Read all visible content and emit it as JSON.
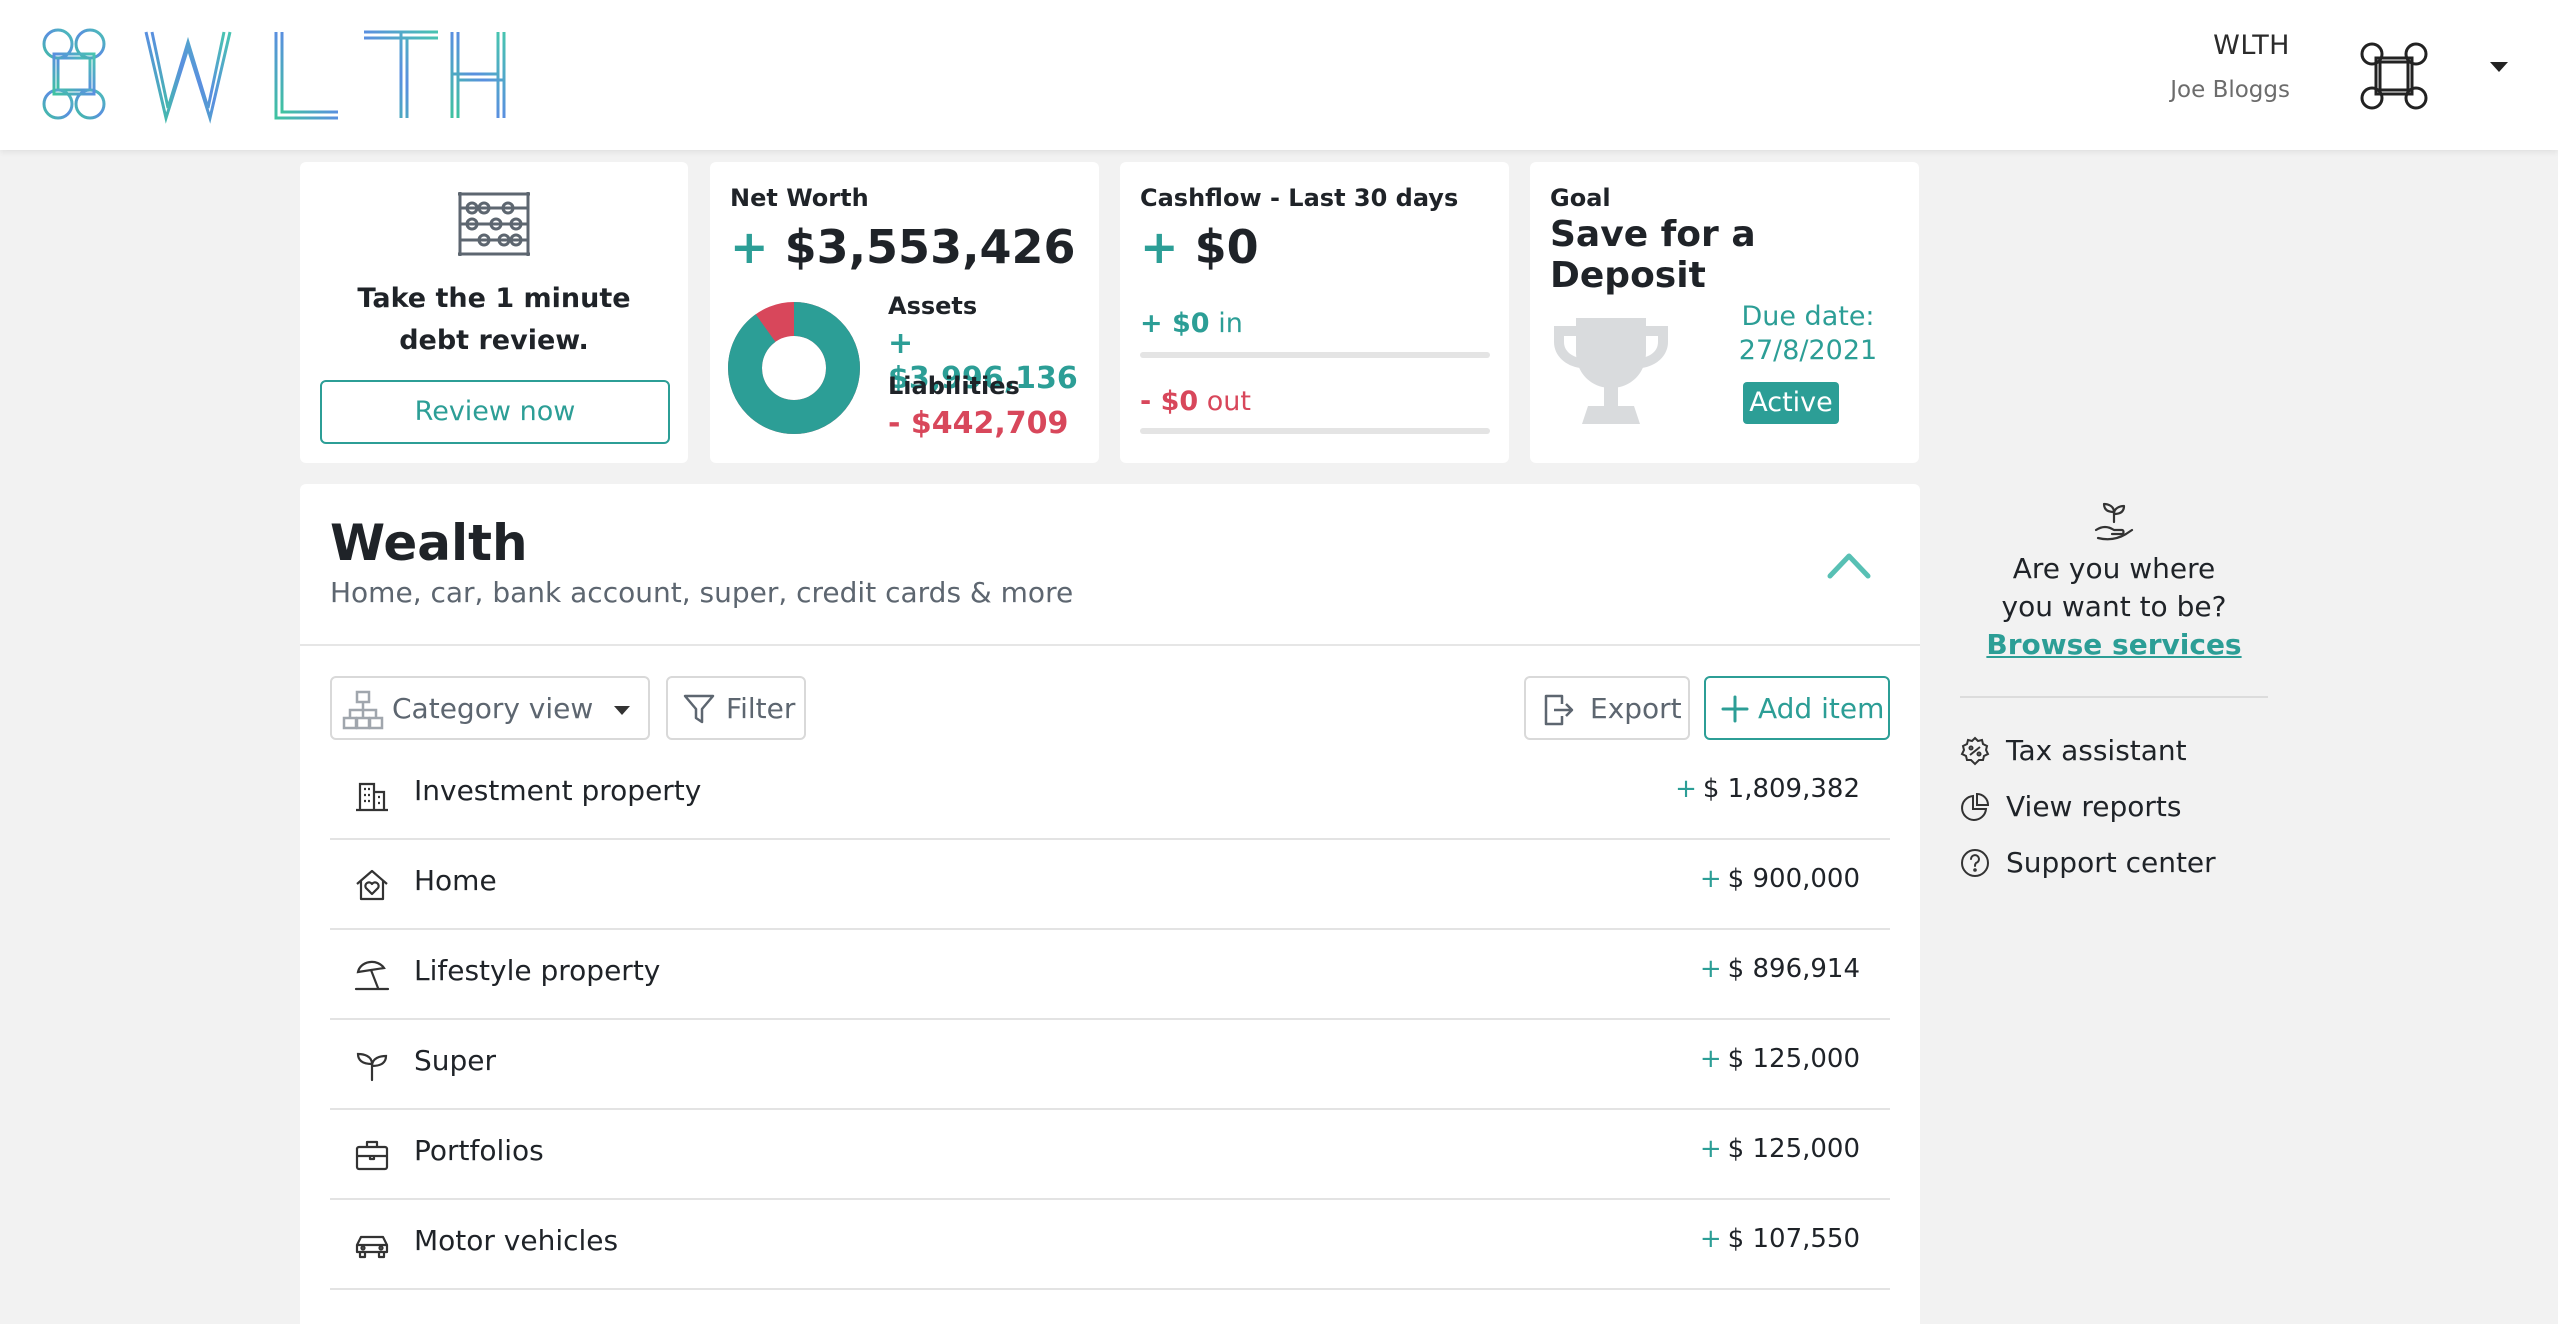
{
  "header": {
    "brand": "WLTH",
    "org_name": "WLTH",
    "user_name": "Joe Bloggs"
  },
  "cards": {
    "debt": {
      "line1": "Take the 1 minute",
      "line2": "debt review.",
      "button": "Review now"
    },
    "net_worth": {
      "title": "Net Worth",
      "sign": "+",
      "value": "$3,553,426",
      "assets_label": "Assets",
      "assets_value": "+ $3,996,136",
      "liabilities_label": "Liabilities",
      "liabilities_value": "- $442,709",
      "assets_fraction": 0.9
    },
    "cashflow": {
      "title": "Cashflow - Last 30 days",
      "sign": "+",
      "value": "$0",
      "in_amount": "+ $0",
      "in_label": "in",
      "out_amount": "- $0",
      "out_label": "out"
    },
    "goal": {
      "label": "Goal",
      "title": "Save for a Deposit",
      "due_label": "Due date:",
      "due_date": "27/8/2021",
      "status": "Active"
    }
  },
  "wealth": {
    "title": "Wealth",
    "subtitle": "Home, car, bank account, super, credit cards & more",
    "controls": {
      "category_view": "Category view",
      "filter": "Filter",
      "export": "Export",
      "add_item": "Add item"
    },
    "rows": [
      {
        "icon": "building-icon",
        "name": "Investment property",
        "sign": "+",
        "value": "$ 1,809,382"
      },
      {
        "icon": "home-icon",
        "name": "Home",
        "sign": "+",
        "value": "$ 900,000"
      },
      {
        "icon": "beach-umbrella-icon",
        "name": "Lifestyle property",
        "sign": "+",
        "value": "$ 896,914"
      },
      {
        "icon": "sprout-icon",
        "name": "Super",
        "sign": "+",
        "value": "$ 125,000"
      },
      {
        "icon": "briefcase-icon",
        "name": "Portfolios",
        "sign": "+",
        "value": "$ 125,000"
      },
      {
        "icon": "car-icon",
        "name": "Motor vehicles",
        "sign": "+",
        "value": "$ 107,550"
      }
    ]
  },
  "sidebar": {
    "question_line1": "Are you where",
    "question_line2": "you want to be?",
    "browse_link": "Browse services",
    "links": [
      {
        "icon": "tax-badge-icon",
        "label": "Tax assistant"
      },
      {
        "icon": "pie-chart-icon",
        "label": "View reports"
      },
      {
        "icon": "help-circle-icon",
        "label": "Support center"
      }
    ]
  },
  "colors": {
    "accent": "#2c9e96",
    "negative": "#d8475b",
    "background": "#f2f2f2"
  }
}
